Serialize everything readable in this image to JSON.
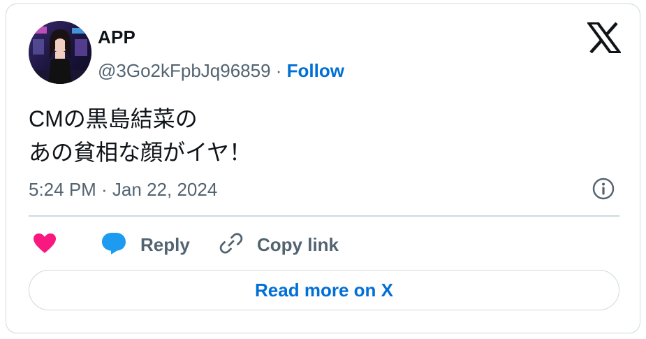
{
  "author": {
    "name": "APP",
    "handle": "@3Go2kFpbJq96859",
    "separator": " · ",
    "follow_label": "Follow"
  },
  "tweet": {
    "line1": "CMの黒島結菜の",
    "line2": "あの貧相な顔がイヤ！",
    "timestamp": "5:24 PM · Jan 22, 2024"
  },
  "actions": {
    "reply_label": "Reply",
    "copy_label": "Copy link"
  },
  "read_more_label": "Read more on X",
  "icons": {
    "logo": "x-logo-icon",
    "info": "info-icon",
    "like": "heart-icon",
    "reply": "speech-bubble-icon",
    "copy": "link-icon"
  },
  "colors": {
    "link": "#006fd6",
    "heart": "#f91880",
    "reply_bubble": "#1d9bf0",
    "secondary_text": "#536471",
    "border": "#cfd9de"
  }
}
